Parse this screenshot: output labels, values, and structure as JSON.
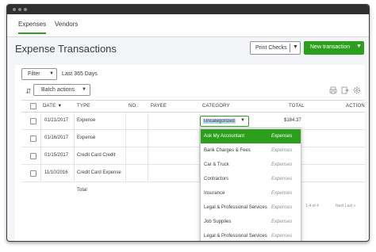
{
  "tabs": [
    {
      "label": "Expenses",
      "active": true
    },
    {
      "label": "Vendors",
      "active": false
    }
  ],
  "page": {
    "title": "Expense Transactions",
    "print_checks": "Print Checks",
    "new_transaction": "New transaction"
  },
  "toolbar": {
    "filter": "Filter",
    "date_range": "Last 365 Days",
    "batch_actions": "Batch actions"
  },
  "table": {
    "headers": {
      "date": "DATE ▼",
      "type": "TYPE",
      "no": "NO.",
      "payee": "PAYEE",
      "category": "CATEGORY",
      "total": "TOTAL",
      "action": "ACTION"
    },
    "rows": [
      {
        "date": "01/21/2017",
        "type": "Expense",
        "total": "$184.37"
      },
      {
        "date": "01/16/2017",
        "type": "Expense",
        "total": ""
      },
      {
        "date": "01/15/2017",
        "type": "Credit Card Credit",
        "total": ""
      },
      {
        "date": "11/10/2016",
        "type": "Credit Card Expense",
        "total": ""
      }
    ],
    "total_label": "Total"
  },
  "category_select": {
    "value": "Uncategorized"
  },
  "dropdown": {
    "items": [
      {
        "name": "Ask My Accountant",
        "type": "Expenses",
        "selected": true
      },
      {
        "name": "Bank Charges & Fees",
        "type": "Expenses"
      },
      {
        "name": "Car & Truck",
        "type": "Expenses"
      },
      {
        "name": "Contractors",
        "type": "Expenses"
      },
      {
        "name": "Insurance",
        "type": "Expenses"
      },
      {
        "name": "Legal & Professional Services",
        "type": "Expenses"
      },
      {
        "name": "Job Supplies",
        "type": "Expenses"
      },
      {
        "name": "Legal & Professional Services",
        "type": "Expenses"
      }
    ]
  },
  "pager": {
    "range": "1-4 of 4",
    "next": "Next Last »"
  },
  "colors": {
    "accent": "#2ca01c",
    "titlebar": "#303033"
  }
}
